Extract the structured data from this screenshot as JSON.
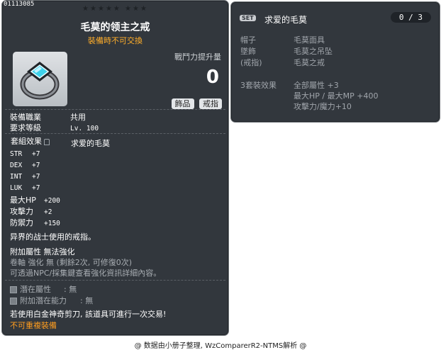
{
  "item_id": "01113085",
  "stars": "★★★★★   ★★★",
  "title": "毛莫的领主之戒",
  "subtitle": "裝備時不可交換",
  "attack_label": "戰鬥力提升量",
  "attack_value": "0",
  "badges": [
    "飾品",
    "戒指"
  ],
  "job_label": "裝備職業",
  "job_value": "共用",
  "level_label": "要求等級",
  "level_value": "Lv. 100",
  "set_effect_label": "套組效果",
  "set_effect_value": "求爱的毛莫",
  "stats": [
    {
      "name": "STR",
      "value": "+7"
    },
    {
      "name": "DEX",
      "value": "+7"
    },
    {
      "name": "INT",
      "value": "+7"
    },
    {
      "name": "LUK",
      "value": "+7"
    },
    {
      "name": "最大HP",
      "value": "+200"
    },
    {
      "name": "攻擊力",
      "value": "+2"
    },
    {
      "name": "防禦力",
      "value": "+150"
    }
  ],
  "description": "异界的战士使用的戒指。",
  "extra_attr": "附加屬性 無法強化",
  "upgrade_info": "卷軸 強化 無 (剩餘2次, 可修復0次)",
  "npc_info": "可透過NPC/採集鍵查看強化資訊詳細內容。",
  "potential_label": "潛在屬性",
  "potential_value": ": 無",
  "add_potential_label": "附加潛在能力",
  "add_potential_value": ": 無",
  "scissors_info": "若使用白金神奇剪刀, 該道具可進行一次交易!",
  "no_duplicate": "不可重複裝備",
  "footer": "@ 数据由小册子整理, WzComparerR2-NTMS解析 @",
  "set_panel": {
    "tag": "SET",
    "name": "求爱的毛莫",
    "count": "0 / 3",
    "items": [
      {
        "slot": "帽子",
        "name": "毛莫面具"
      },
      {
        "slot": "墜飾",
        "name": "毛莫之吊坠"
      },
      {
        "slot": "(戒指)",
        "name": "毛莫之戒"
      }
    ],
    "effect_label": "3套裝效果",
    "effects": [
      "全部屬性 +3",
      "最大HP / 最大MP  +400",
      "攻擊力/魔力+10"
    ]
  }
}
